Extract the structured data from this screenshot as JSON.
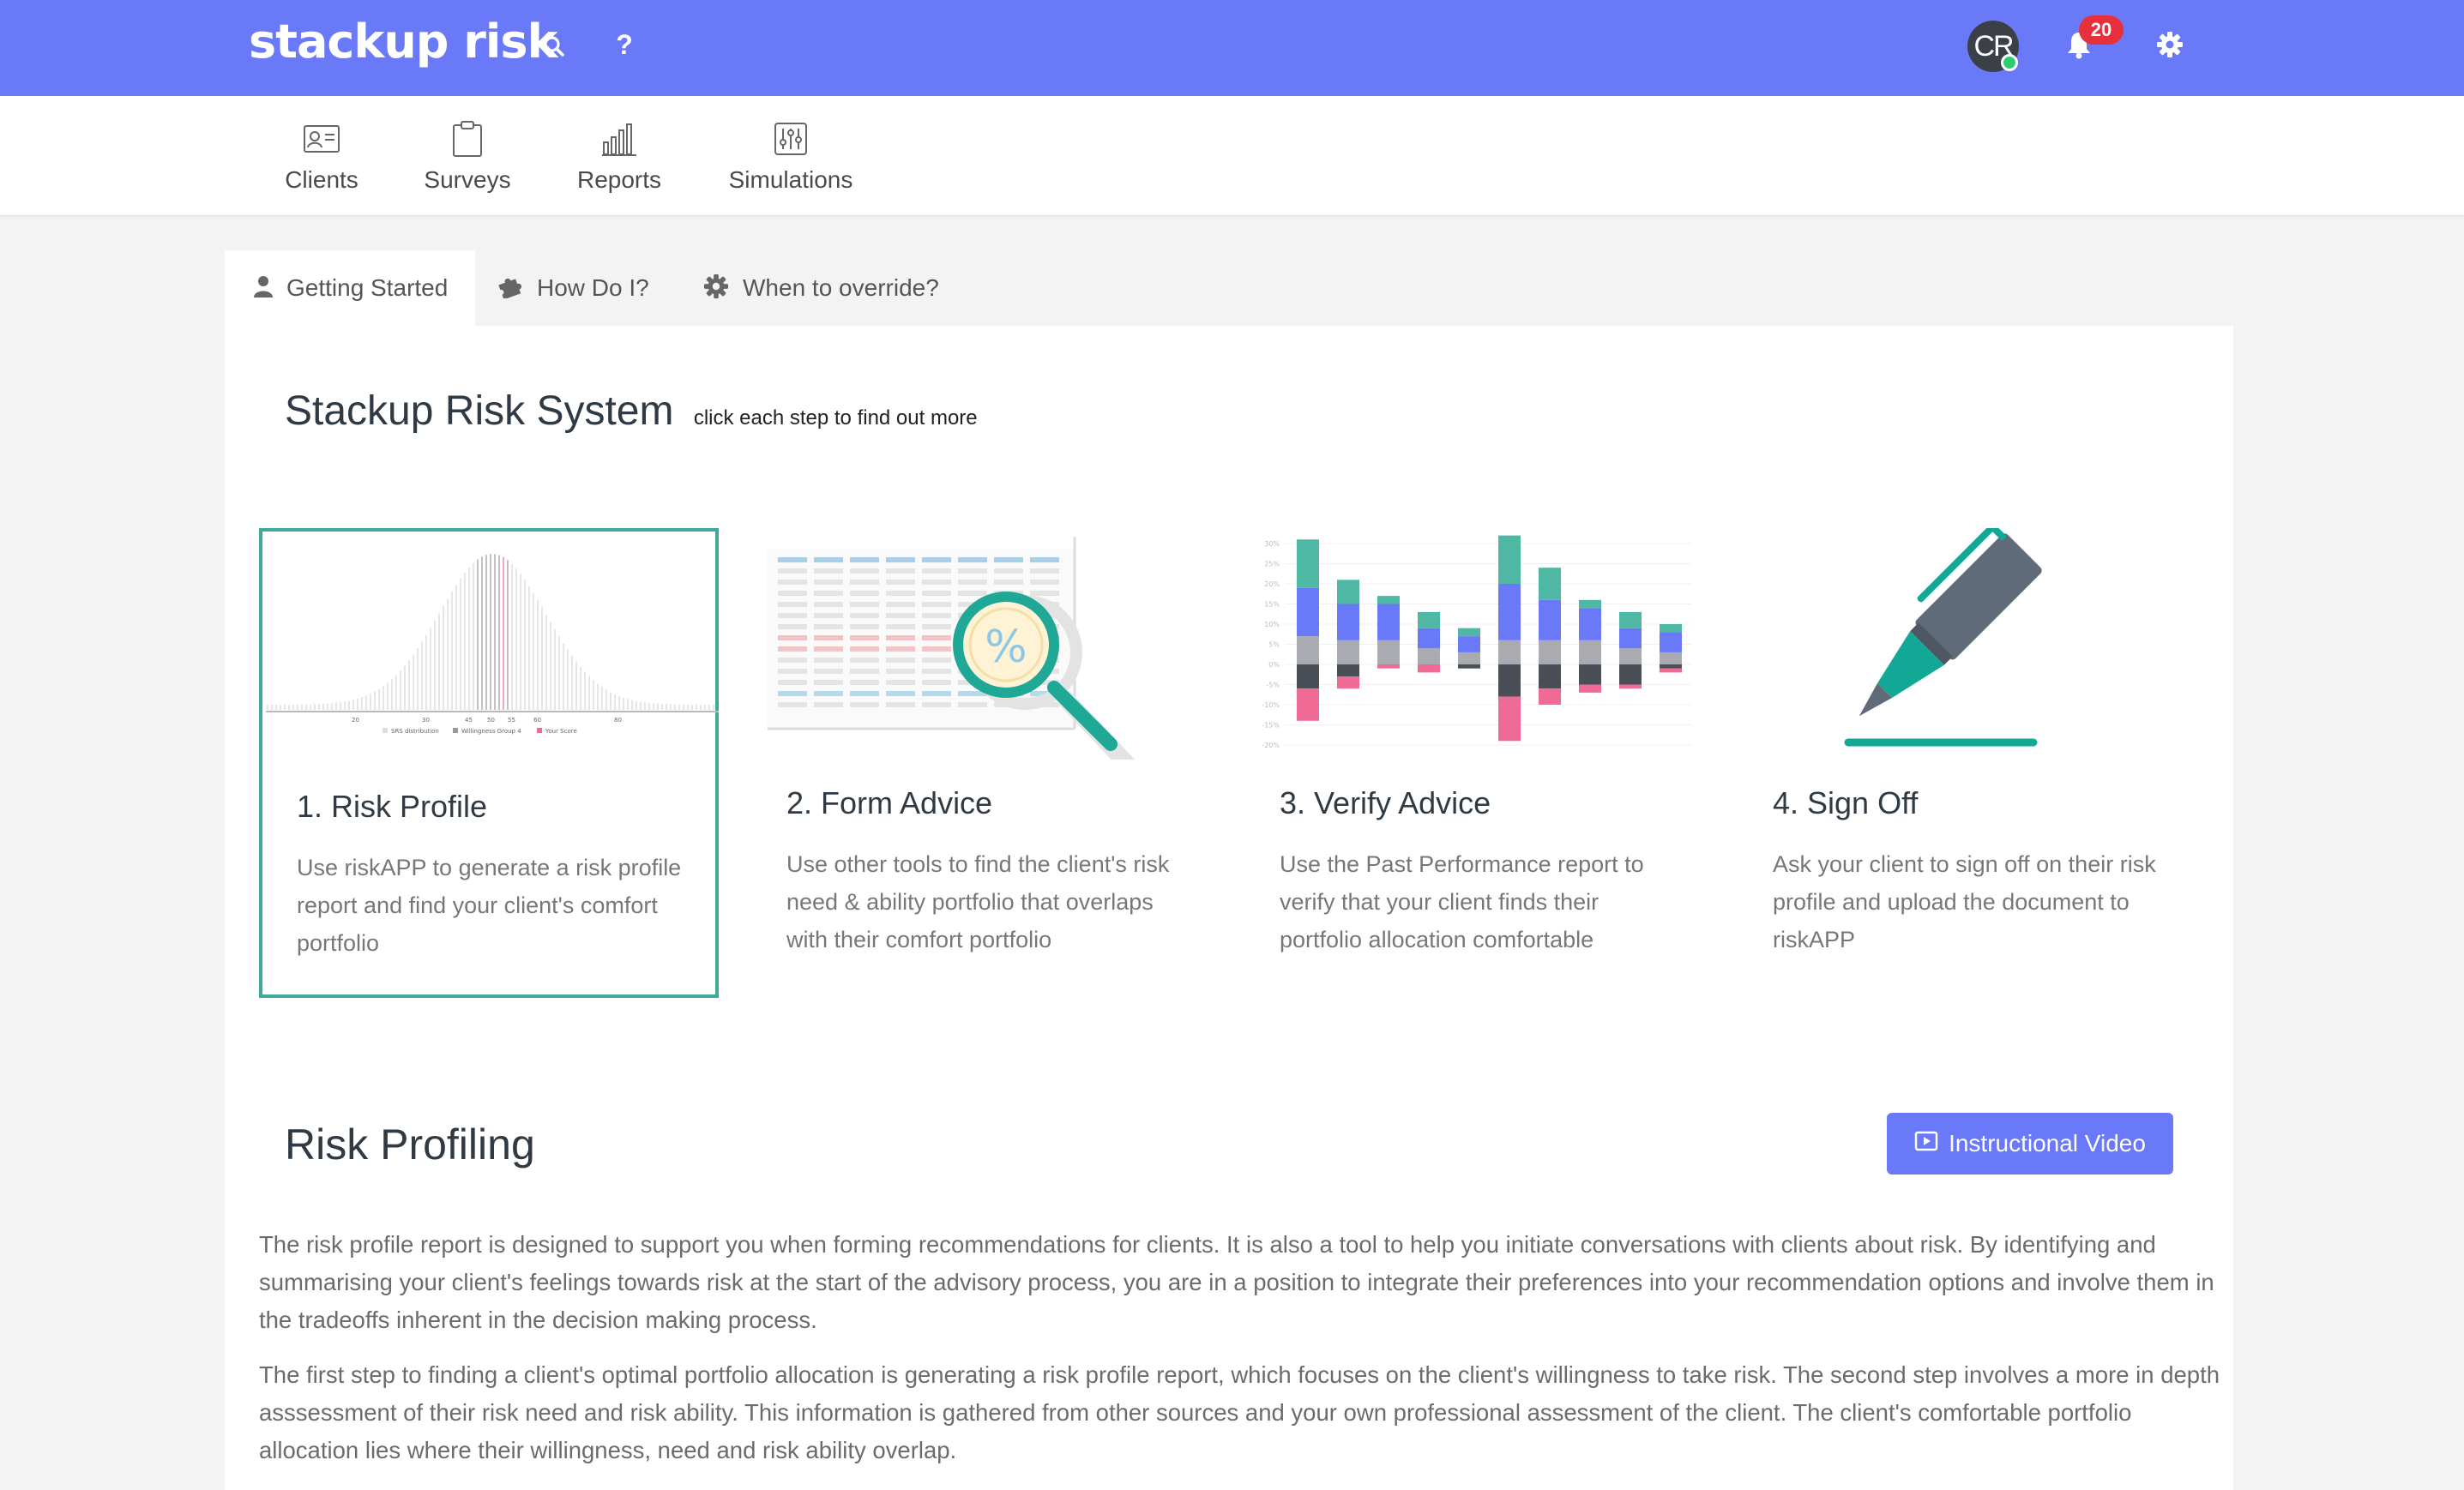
{
  "header": {
    "brand": "stackup risk",
    "help_glyph": "?",
    "avatar_initials": "CR",
    "notification_count": "20",
    "icons": [
      "search-icon",
      "help-icon",
      "bell-icon",
      "gear-icon"
    ]
  },
  "nav": {
    "items": [
      {
        "label": "Clients",
        "icon": "id-card-icon"
      },
      {
        "label": "Surveys",
        "icon": "clipboard-icon"
      },
      {
        "label": "Reports",
        "icon": "bar-chart-icon"
      },
      {
        "label": "Simulations",
        "icon": "sliders-icon"
      }
    ]
  },
  "tabs": [
    {
      "label": "Getting Started",
      "icon": "user-icon",
      "active": true
    },
    {
      "label": "How Do I?",
      "icon": "puzzle-icon",
      "active": false
    },
    {
      "label": "When to override?",
      "icon": "gear-icon",
      "active": false
    }
  ],
  "system": {
    "title": "Stackup Risk System",
    "subtitle": "click each step to find out more"
  },
  "steps": [
    {
      "title": "1. Risk Profile",
      "description": "Use riskAPP to generate a risk profile report and find your client's comfort portfolio",
      "active": true,
      "illustration": {
        "tick_labels": [
          "20",
          "30",
          "45",
          "50",
          "55",
          "60",
          "80"
        ],
        "legend": [
          "SRS distribution",
          "Willingness Group 4",
          "Your Score"
        ]
      }
    },
    {
      "title": "2. Form Advice",
      "description": "Use other tools to find the client's risk need & ability portfolio that overlaps with their comfort portfolio",
      "active": false,
      "illustration": {
        "glyph": "%"
      }
    },
    {
      "title": "3. Verify Advice",
      "description": "Use the Past Performance report to verify that your client finds their portfolio allocation comfortable",
      "active": false,
      "illustration": {
        "axis_labels": [
          "30%",
          "25%",
          "20%",
          "15%",
          "10%",
          "5%",
          "0%",
          "-5%",
          "-10%",
          "-15%",
          "-20%"
        ]
      }
    },
    {
      "title": "4. Sign Off",
      "description": "Ask your client to sign off on their risk profile and upload the document to riskAPP",
      "active": false
    }
  ],
  "risk_profiling": {
    "title": "Risk Profiling",
    "video_button": "Instructional Video",
    "paragraphs": [
      "The risk profile report is designed to support you when forming recommendations for clients. It is also a tool to help you initiate conversations with clients about risk. By identifying and summarising your client's feelings towards risk at the start of the advisory process, you are in a position to integrate their preferences into your recommendation options and involve them in the tradeoffs inherent in the decision making process.",
      "The first step to finding a client's optimal portfolio allocation is generating a risk profile report, which focuses on the client's willingness to take risk. The second step involves a more in depth asssessment of their risk need and risk ability. This information is gathered from other sources and your own professional assessment of the client. The client's comfortable portfolio allocation lies where their willingness, need and risk ability overlap."
    ]
  },
  "colors": {
    "brand": "#6979f8",
    "teal": "#3fa99a",
    "slate": "#5f6b78",
    "pink": "#ef6b96",
    "badge": "#e8303c"
  }
}
